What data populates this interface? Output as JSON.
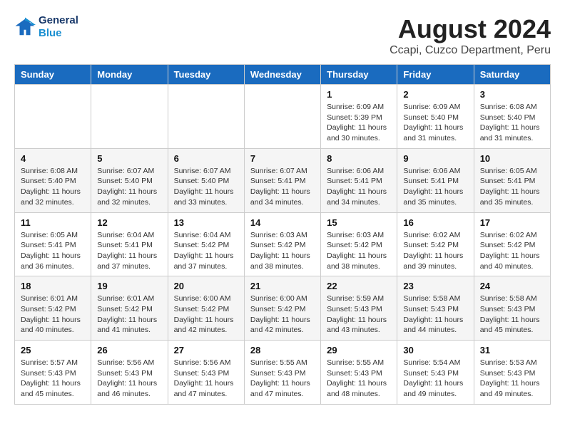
{
  "header": {
    "logo_line1": "General",
    "logo_line2": "Blue",
    "main_title": "August 2024",
    "subtitle": "Ccapi, Cuzco Department, Peru"
  },
  "weekdays": [
    "Sunday",
    "Monday",
    "Tuesday",
    "Wednesday",
    "Thursday",
    "Friday",
    "Saturday"
  ],
  "weeks": [
    [
      {
        "day": "",
        "sunrise": "",
        "sunset": "",
        "daylight": ""
      },
      {
        "day": "",
        "sunrise": "",
        "sunset": "",
        "daylight": ""
      },
      {
        "day": "",
        "sunrise": "",
        "sunset": "",
        "daylight": ""
      },
      {
        "day": "",
        "sunrise": "",
        "sunset": "",
        "daylight": ""
      },
      {
        "day": "1",
        "sunrise": "Sunrise: 6:09 AM",
        "sunset": "Sunset: 5:39 PM",
        "daylight": "Daylight: 11 hours and 30 minutes."
      },
      {
        "day": "2",
        "sunrise": "Sunrise: 6:09 AM",
        "sunset": "Sunset: 5:40 PM",
        "daylight": "Daylight: 11 hours and 31 minutes."
      },
      {
        "day": "3",
        "sunrise": "Sunrise: 6:08 AM",
        "sunset": "Sunset: 5:40 PM",
        "daylight": "Daylight: 11 hours and 31 minutes."
      }
    ],
    [
      {
        "day": "4",
        "sunrise": "Sunrise: 6:08 AM",
        "sunset": "Sunset: 5:40 PM",
        "daylight": "Daylight: 11 hours and 32 minutes."
      },
      {
        "day": "5",
        "sunrise": "Sunrise: 6:07 AM",
        "sunset": "Sunset: 5:40 PM",
        "daylight": "Daylight: 11 hours and 32 minutes."
      },
      {
        "day": "6",
        "sunrise": "Sunrise: 6:07 AM",
        "sunset": "Sunset: 5:40 PM",
        "daylight": "Daylight: 11 hours and 33 minutes."
      },
      {
        "day": "7",
        "sunrise": "Sunrise: 6:07 AM",
        "sunset": "Sunset: 5:41 PM",
        "daylight": "Daylight: 11 hours and 34 minutes."
      },
      {
        "day": "8",
        "sunrise": "Sunrise: 6:06 AM",
        "sunset": "Sunset: 5:41 PM",
        "daylight": "Daylight: 11 hours and 34 minutes."
      },
      {
        "day": "9",
        "sunrise": "Sunrise: 6:06 AM",
        "sunset": "Sunset: 5:41 PM",
        "daylight": "Daylight: 11 hours and 35 minutes."
      },
      {
        "day": "10",
        "sunrise": "Sunrise: 6:05 AM",
        "sunset": "Sunset: 5:41 PM",
        "daylight": "Daylight: 11 hours and 35 minutes."
      }
    ],
    [
      {
        "day": "11",
        "sunrise": "Sunrise: 6:05 AM",
        "sunset": "Sunset: 5:41 PM",
        "daylight": "Daylight: 11 hours and 36 minutes."
      },
      {
        "day": "12",
        "sunrise": "Sunrise: 6:04 AM",
        "sunset": "Sunset: 5:41 PM",
        "daylight": "Daylight: 11 hours and 37 minutes."
      },
      {
        "day": "13",
        "sunrise": "Sunrise: 6:04 AM",
        "sunset": "Sunset: 5:42 PM",
        "daylight": "Daylight: 11 hours and 37 minutes."
      },
      {
        "day": "14",
        "sunrise": "Sunrise: 6:03 AM",
        "sunset": "Sunset: 5:42 PM",
        "daylight": "Daylight: 11 hours and 38 minutes."
      },
      {
        "day": "15",
        "sunrise": "Sunrise: 6:03 AM",
        "sunset": "Sunset: 5:42 PM",
        "daylight": "Daylight: 11 hours and 38 minutes."
      },
      {
        "day": "16",
        "sunrise": "Sunrise: 6:02 AM",
        "sunset": "Sunset: 5:42 PM",
        "daylight": "Daylight: 11 hours and 39 minutes."
      },
      {
        "day": "17",
        "sunrise": "Sunrise: 6:02 AM",
        "sunset": "Sunset: 5:42 PM",
        "daylight": "Daylight: 11 hours and 40 minutes."
      }
    ],
    [
      {
        "day": "18",
        "sunrise": "Sunrise: 6:01 AM",
        "sunset": "Sunset: 5:42 PM",
        "daylight": "Daylight: 11 hours and 40 minutes."
      },
      {
        "day": "19",
        "sunrise": "Sunrise: 6:01 AM",
        "sunset": "Sunset: 5:42 PM",
        "daylight": "Daylight: 11 hours and 41 minutes."
      },
      {
        "day": "20",
        "sunrise": "Sunrise: 6:00 AM",
        "sunset": "Sunset: 5:42 PM",
        "daylight": "Daylight: 11 hours and 42 minutes."
      },
      {
        "day": "21",
        "sunrise": "Sunrise: 6:00 AM",
        "sunset": "Sunset: 5:42 PM",
        "daylight": "Daylight: 11 hours and 42 minutes."
      },
      {
        "day": "22",
        "sunrise": "Sunrise: 5:59 AM",
        "sunset": "Sunset: 5:43 PM",
        "daylight": "Daylight: 11 hours and 43 minutes."
      },
      {
        "day": "23",
        "sunrise": "Sunrise: 5:58 AM",
        "sunset": "Sunset: 5:43 PM",
        "daylight": "Daylight: 11 hours and 44 minutes."
      },
      {
        "day": "24",
        "sunrise": "Sunrise: 5:58 AM",
        "sunset": "Sunset: 5:43 PM",
        "daylight": "Daylight: 11 hours and 45 minutes."
      }
    ],
    [
      {
        "day": "25",
        "sunrise": "Sunrise: 5:57 AM",
        "sunset": "Sunset: 5:43 PM",
        "daylight": "Daylight: 11 hours and 45 minutes."
      },
      {
        "day": "26",
        "sunrise": "Sunrise: 5:56 AM",
        "sunset": "Sunset: 5:43 PM",
        "daylight": "Daylight: 11 hours and 46 minutes."
      },
      {
        "day": "27",
        "sunrise": "Sunrise: 5:56 AM",
        "sunset": "Sunset: 5:43 PM",
        "daylight": "Daylight: 11 hours and 47 minutes."
      },
      {
        "day": "28",
        "sunrise": "Sunrise: 5:55 AM",
        "sunset": "Sunset: 5:43 PM",
        "daylight": "Daylight: 11 hours and 47 minutes."
      },
      {
        "day": "29",
        "sunrise": "Sunrise: 5:55 AM",
        "sunset": "Sunset: 5:43 PM",
        "daylight": "Daylight: 11 hours and 48 minutes."
      },
      {
        "day": "30",
        "sunrise": "Sunrise: 5:54 AM",
        "sunset": "Sunset: 5:43 PM",
        "daylight": "Daylight: 11 hours and 49 minutes."
      },
      {
        "day": "31",
        "sunrise": "Sunrise: 5:53 AM",
        "sunset": "Sunset: 5:43 PM",
        "daylight": "Daylight: 11 hours and 49 minutes."
      }
    ]
  ]
}
